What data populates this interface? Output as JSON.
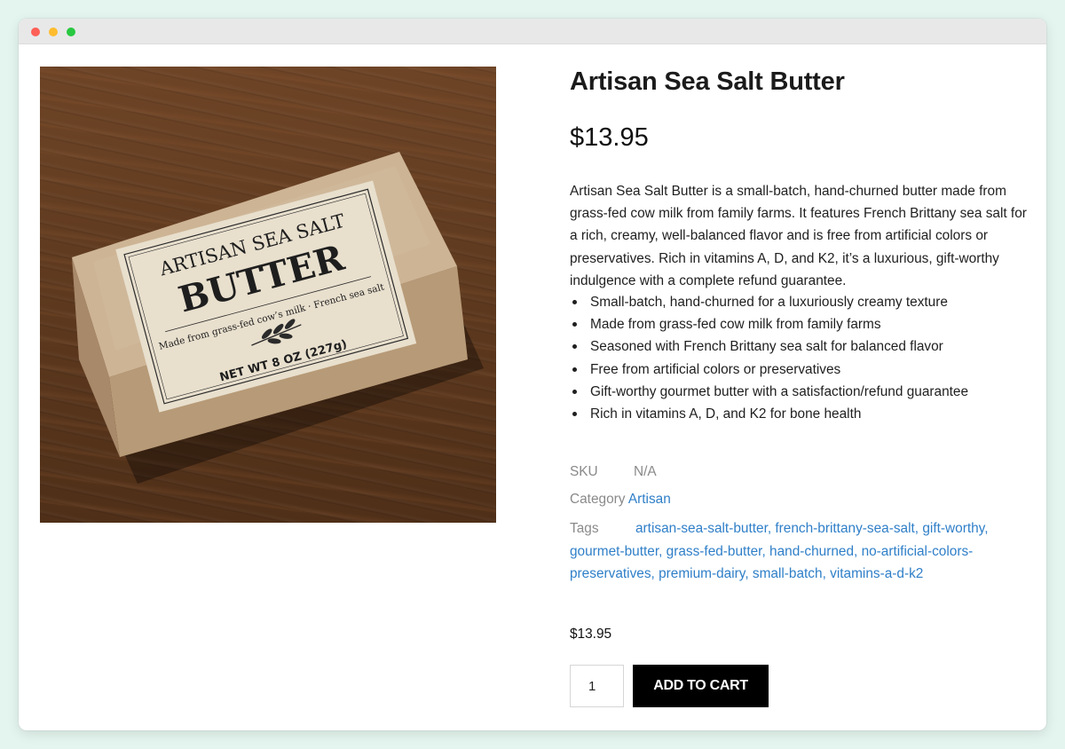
{
  "product": {
    "title": "Artisan Sea Salt Butter",
    "price": "$13.95",
    "description": "Artisan Sea Salt Butter is a small-batch, hand-churned butter made from grass-fed cow milk from family farms. It features French Brittany sea salt for a rich, creamy, well-balanced flavor and is free from artificial colors or preservatives. Rich in vitamins A, D, and K2, it’s a luxurious, gift-worthy indulgence with a complete refund guarantee.",
    "features": [
      "Small-batch, hand-churned for a luxuriously creamy texture",
      "Made from grass-fed cow milk from family farms",
      "Seasoned with French Brittany sea salt for balanced flavor",
      "Free from artificial colors or preservatives",
      "Gift-worthy gourmet butter with a satisfaction/refund guarantee",
      "Rich in vitamins A, D, and K2 for bone health"
    ],
    "image_label": {
      "line1": "ARTISAN SEA SALT",
      "line2": "BUTTER",
      "line3": "Made from grass-fed cow’s milk · French sea salt",
      "line4": "NET WT 8 OZ (227g)"
    }
  },
  "meta": {
    "sku_label": "SKU",
    "sku_value": "N/A",
    "category_label": "Category",
    "category_value": "Artisan",
    "tags_label": "Tags",
    "tags": [
      "artisan-sea-salt-butter",
      "french-brittany-sea-salt",
      "gift-worthy",
      "gourmet-butter",
      "grass-fed-butter",
      "hand-churned",
      "no-artificial-colors-preservatives",
      "premium-dairy",
      "small-batch",
      "vitamins-a-d-k2"
    ]
  },
  "cart": {
    "price": "$13.95",
    "quantity": "1",
    "add_to_cart_label": "ADD TO CART"
  },
  "colors": {
    "link": "#2f7fc8",
    "button": "#000000",
    "page_bg": "#e4f4ee"
  }
}
